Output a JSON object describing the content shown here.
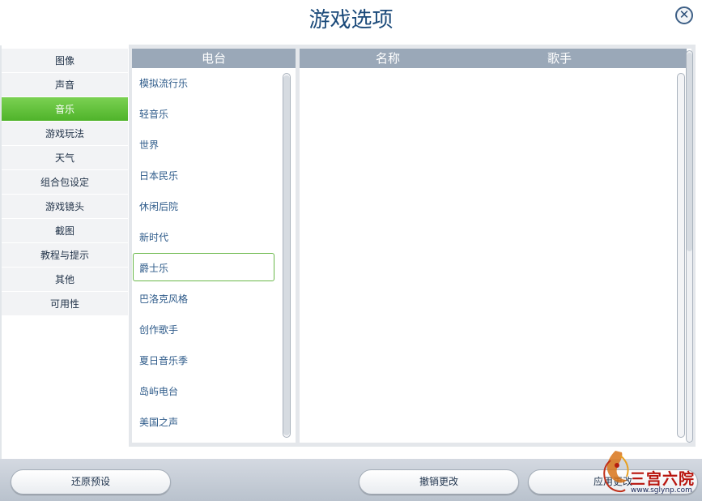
{
  "dialog": {
    "title": "游戏选项",
    "close_symbol": "✕"
  },
  "sidebar": {
    "items": [
      {
        "label": "图像"
      },
      {
        "label": "声音"
      },
      {
        "label": "音乐",
        "active": true
      },
      {
        "label": "游戏玩法"
      },
      {
        "label": "天气"
      },
      {
        "label": "组合包设定"
      },
      {
        "label": "游戏镜头"
      },
      {
        "label": "截图"
      },
      {
        "label": "教程与提示"
      },
      {
        "label": "其他"
      },
      {
        "label": "可用性"
      }
    ]
  },
  "stations": {
    "header": "电台",
    "items": [
      "模拟流行乐",
      "轻音乐",
      "世界",
      "日本民乐",
      "休闲后院",
      "新时代",
      "爵士乐",
      "巴洛克风格",
      "创作歌手",
      "夏日音乐季",
      "岛屿电台",
      "美国之声"
    ],
    "selected": "爵士乐"
  },
  "songs": {
    "headers": {
      "name": "名称",
      "artist": "歌手"
    }
  },
  "footer": {
    "restore_defaults": "还原预设",
    "revert_changes": "撤销更改",
    "apply_changes": "应用更改"
  },
  "watermark": {
    "text": "三宫六院",
    "url": "www.sglynp.com"
  },
  "colors": {
    "accent": "#5cbf35",
    "header_bg": "#9aa8b8",
    "title": "#1b4a7a"
  }
}
